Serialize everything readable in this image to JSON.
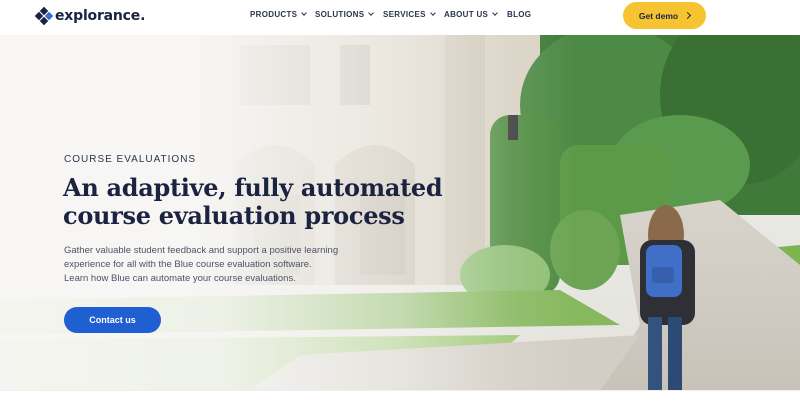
{
  "header": {
    "logo_text": "explorance.",
    "nav": [
      {
        "label": "PRODUCTS",
        "has_dropdown": true
      },
      {
        "label": "SOLUTIONS",
        "has_dropdown": true
      },
      {
        "label": "SERVICES",
        "has_dropdown": true
      },
      {
        "label": "ABOUT US",
        "has_dropdown": true
      },
      {
        "label": "BLOG",
        "has_dropdown": false
      }
    ],
    "cta_label": "Get demo"
  },
  "hero": {
    "eyebrow": "COURSE EVALUATIONS",
    "headline_lines": [
      "An adaptive, fully automated",
      "course evaluation process"
    ],
    "description_lines": [
      "Gather valuable student feedback and support a positive learning",
      "experience for all with the Blue course evaluation software.",
      "Learn how Blue can automate your course evaluations."
    ],
    "button_label": "Contact us"
  },
  "colors": {
    "brand_navy": "#1c2340",
    "cta_yellow": "#f7c431",
    "button_blue": "#1f5fd1"
  },
  "icons": {
    "logo": "diamond-cluster-logo-icon",
    "dropdown": "chevron-down-icon",
    "cta_arrow": "chevron-right-icon"
  }
}
